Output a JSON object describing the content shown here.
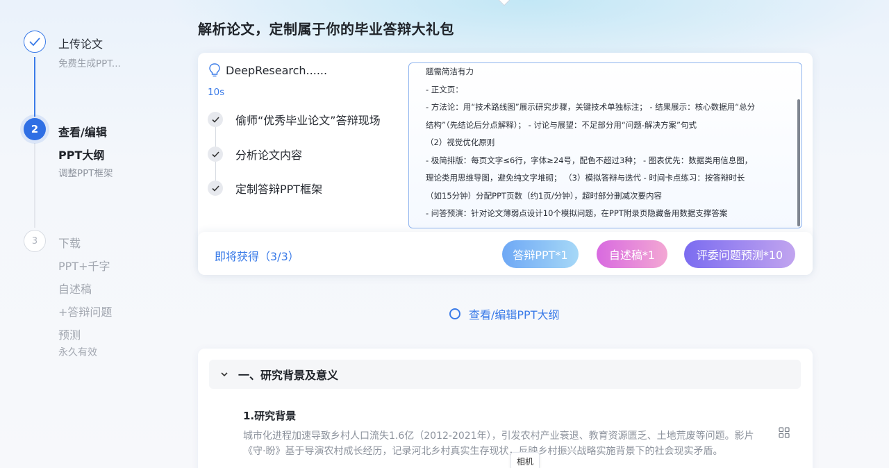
{
  "stepper": {
    "step1": {
      "title": "上传论文",
      "sub": "免费生成PPT..."
    },
    "step2": {
      "number": "2",
      "title": "查看/编辑",
      "title2": "PPT大纲",
      "sub": "调整PPT框架"
    },
    "step3": {
      "number": "3",
      "title": "下载",
      "lines": [
        "PPT+千字",
        "自述稿",
        "+答辩问题",
        "预测"
      ],
      "sub": "永久有效"
    }
  },
  "page_title": "解析论文，定制属于你的毕业答辩大礼包",
  "research": {
    "label": "DeepResearch......",
    "timer": "10s",
    "tasks": [
      "偷师“优秀毕业论文”答辩现场",
      "分析论文内容",
      "定制答辩PPT框架"
    ]
  },
  "outline_lines": [
    "题需简洁有力",
    "- 正文页：",
    "- 方法论：用“技术路线图”展示研究步骤，关键技术单独标注；  - 结果展示：核心数据用“总分",
    "结构”（先结论后分点解释）；  - 讨论与展望：不足部分用“问题-解决方案”句式",
    "（2）视觉优化原则",
    "- 极简排版：每页文字≤6行，字体≥24号，配色不超过3种；  - 图表优先：数据类用信息图，",
    "理论类用思维导图，避免纯文字堆砌；  （3）模拟答辩与迭代 - 时间卡点练习：按答辩时长",
    "（如15分钟）分配PPT页数（约1页/分钟），超时部分删减次要内容",
    "- 问答预演：针对论文薄弱点设计10个模拟问题，在PPT附录页隐藏备用数据支撑答案"
  ],
  "rewards": {
    "label": "即将获得（3/3）",
    "items": [
      "答辩PPT*1",
      "自述稿*1",
      "评委问题预测*10"
    ]
  },
  "view_link": "查看/编辑PPT大纲",
  "section": {
    "title": "一、研究背景及意义",
    "sub_title": "1.研究背景",
    "paragraph": "城市化进程加速导致乡村人口流失1.6亿（2012-2021年），引发农村产业衰退、教育资源匮乏、土地荒废等问题。影片《守·盼》基于导演农村成长经历，记录河北乡村真实生存现状，反映乡村振兴战略实施背景下的社会现实矛盾。"
  },
  "tooltip": "相机",
  "colors": {
    "accent": "#3a7be8",
    "pill_ppt": "#6ea8f5",
    "pill_script": "#d86ae0",
    "pill_questions": "#7b6cf0"
  },
  "icons": [
    "check-icon",
    "bulb-icon",
    "chevron-down-icon",
    "grid-icon",
    "ring-icon"
  ]
}
